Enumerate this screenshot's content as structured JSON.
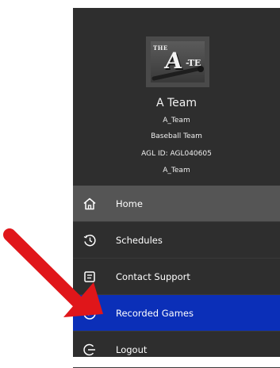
{
  "profile": {
    "logo_text_top": "THE",
    "logo_text_main": "A",
    "logo_text_suffix": "-TE",
    "team_name": "A Team",
    "handle": "A_Team",
    "sport": "Baseball Team",
    "agl_id": "AGL ID: AGL040605",
    "handle_2": "A_Team"
  },
  "menu": {
    "items": [
      {
        "label": "Home",
        "icon": "home-icon"
      },
      {
        "label": "Schedules",
        "icon": "history-icon"
      },
      {
        "label": "Contact Support",
        "icon": "support-icon"
      },
      {
        "label": "Recorded Games",
        "icon": "recorded-games-icon"
      },
      {
        "label": "Logout",
        "icon": "logout-icon"
      }
    ]
  },
  "colors": {
    "drawer_bg": "#2e2e2e",
    "home_bg": "#555555",
    "active_bg": "#0b2fb8",
    "arrow": "#e0161a"
  }
}
